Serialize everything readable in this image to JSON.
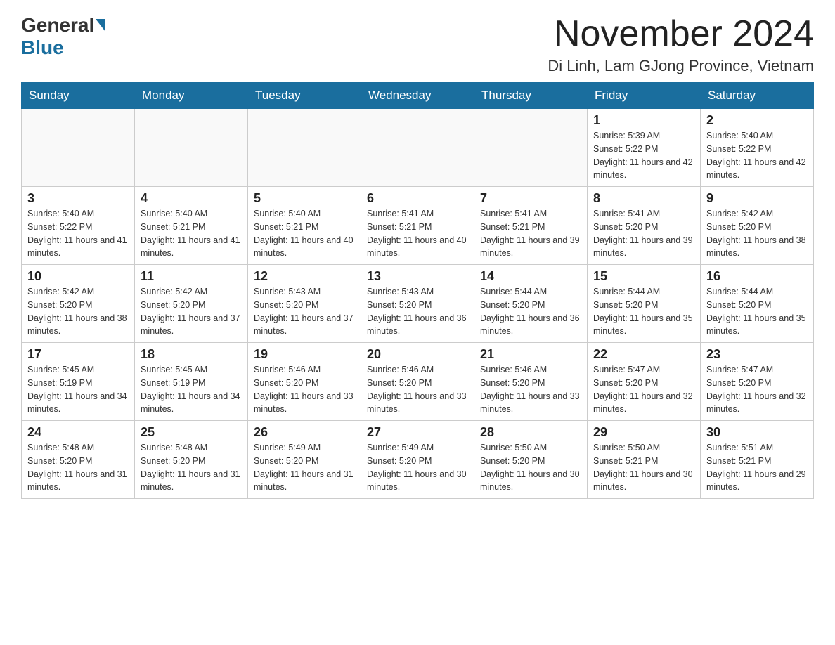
{
  "logo": {
    "general": "General",
    "blue": "Blue"
  },
  "title": "November 2024",
  "subtitle": "Di Linh, Lam GJong Province, Vietnam",
  "weekdays": [
    "Sunday",
    "Monday",
    "Tuesday",
    "Wednesday",
    "Thursday",
    "Friday",
    "Saturday"
  ],
  "weeks": [
    [
      {
        "day": "",
        "info": ""
      },
      {
        "day": "",
        "info": ""
      },
      {
        "day": "",
        "info": ""
      },
      {
        "day": "",
        "info": ""
      },
      {
        "day": "",
        "info": ""
      },
      {
        "day": "1",
        "info": "Sunrise: 5:39 AM\nSunset: 5:22 PM\nDaylight: 11 hours and 42 minutes."
      },
      {
        "day": "2",
        "info": "Sunrise: 5:40 AM\nSunset: 5:22 PM\nDaylight: 11 hours and 42 minutes."
      }
    ],
    [
      {
        "day": "3",
        "info": "Sunrise: 5:40 AM\nSunset: 5:22 PM\nDaylight: 11 hours and 41 minutes."
      },
      {
        "day": "4",
        "info": "Sunrise: 5:40 AM\nSunset: 5:21 PM\nDaylight: 11 hours and 41 minutes."
      },
      {
        "day": "5",
        "info": "Sunrise: 5:40 AM\nSunset: 5:21 PM\nDaylight: 11 hours and 40 minutes."
      },
      {
        "day": "6",
        "info": "Sunrise: 5:41 AM\nSunset: 5:21 PM\nDaylight: 11 hours and 40 minutes."
      },
      {
        "day": "7",
        "info": "Sunrise: 5:41 AM\nSunset: 5:21 PM\nDaylight: 11 hours and 39 minutes."
      },
      {
        "day": "8",
        "info": "Sunrise: 5:41 AM\nSunset: 5:20 PM\nDaylight: 11 hours and 39 minutes."
      },
      {
        "day": "9",
        "info": "Sunrise: 5:42 AM\nSunset: 5:20 PM\nDaylight: 11 hours and 38 minutes."
      }
    ],
    [
      {
        "day": "10",
        "info": "Sunrise: 5:42 AM\nSunset: 5:20 PM\nDaylight: 11 hours and 38 minutes."
      },
      {
        "day": "11",
        "info": "Sunrise: 5:42 AM\nSunset: 5:20 PM\nDaylight: 11 hours and 37 minutes."
      },
      {
        "day": "12",
        "info": "Sunrise: 5:43 AM\nSunset: 5:20 PM\nDaylight: 11 hours and 37 minutes."
      },
      {
        "day": "13",
        "info": "Sunrise: 5:43 AM\nSunset: 5:20 PM\nDaylight: 11 hours and 36 minutes."
      },
      {
        "day": "14",
        "info": "Sunrise: 5:44 AM\nSunset: 5:20 PM\nDaylight: 11 hours and 36 minutes."
      },
      {
        "day": "15",
        "info": "Sunrise: 5:44 AM\nSunset: 5:20 PM\nDaylight: 11 hours and 35 minutes."
      },
      {
        "day": "16",
        "info": "Sunrise: 5:44 AM\nSunset: 5:20 PM\nDaylight: 11 hours and 35 minutes."
      }
    ],
    [
      {
        "day": "17",
        "info": "Sunrise: 5:45 AM\nSunset: 5:19 PM\nDaylight: 11 hours and 34 minutes."
      },
      {
        "day": "18",
        "info": "Sunrise: 5:45 AM\nSunset: 5:19 PM\nDaylight: 11 hours and 34 minutes."
      },
      {
        "day": "19",
        "info": "Sunrise: 5:46 AM\nSunset: 5:20 PM\nDaylight: 11 hours and 33 minutes."
      },
      {
        "day": "20",
        "info": "Sunrise: 5:46 AM\nSunset: 5:20 PM\nDaylight: 11 hours and 33 minutes."
      },
      {
        "day": "21",
        "info": "Sunrise: 5:46 AM\nSunset: 5:20 PM\nDaylight: 11 hours and 33 minutes."
      },
      {
        "day": "22",
        "info": "Sunrise: 5:47 AM\nSunset: 5:20 PM\nDaylight: 11 hours and 32 minutes."
      },
      {
        "day": "23",
        "info": "Sunrise: 5:47 AM\nSunset: 5:20 PM\nDaylight: 11 hours and 32 minutes."
      }
    ],
    [
      {
        "day": "24",
        "info": "Sunrise: 5:48 AM\nSunset: 5:20 PM\nDaylight: 11 hours and 31 minutes."
      },
      {
        "day": "25",
        "info": "Sunrise: 5:48 AM\nSunset: 5:20 PM\nDaylight: 11 hours and 31 minutes."
      },
      {
        "day": "26",
        "info": "Sunrise: 5:49 AM\nSunset: 5:20 PM\nDaylight: 11 hours and 31 minutes."
      },
      {
        "day": "27",
        "info": "Sunrise: 5:49 AM\nSunset: 5:20 PM\nDaylight: 11 hours and 30 minutes."
      },
      {
        "day": "28",
        "info": "Sunrise: 5:50 AM\nSunset: 5:20 PM\nDaylight: 11 hours and 30 minutes."
      },
      {
        "day": "29",
        "info": "Sunrise: 5:50 AM\nSunset: 5:21 PM\nDaylight: 11 hours and 30 minutes."
      },
      {
        "day": "30",
        "info": "Sunrise: 5:51 AM\nSunset: 5:21 PM\nDaylight: 11 hours and 29 minutes."
      }
    ]
  ]
}
